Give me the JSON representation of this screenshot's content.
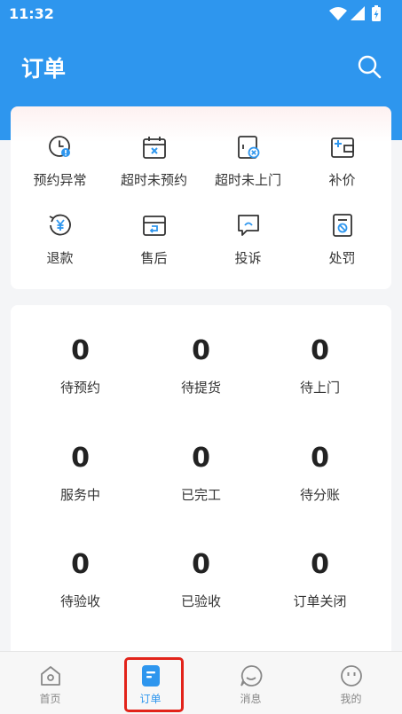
{
  "status_bar": {
    "time": "11:32"
  },
  "header": {
    "title": "订单"
  },
  "quick_actions": [
    {
      "label": "预约异常",
      "icon": "clock-alert-icon"
    },
    {
      "label": "超时未预约",
      "icon": "calendar-x-icon"
    },
    {
      "label": "超时未上门",
      "icon": "door-x-icon"
    },
    {
      "label": "补价",
      "icon": "wallet-plus-icon"
    },
    {
      "label": "退款",
      "icon": "refund-yen-icon"
    },
    {
      "label": "售后",
      "icon": "box-return-icon"
    },
    {
      "label": "投诉",
      "icon": "complaint-message-icon"
    },
    {
      "label": "处罚",
      "icon": "penalty-doc-icon"
    }
  ],
  "stats": [
    {
      "count": "0",
      "label": "待预约"
    },
    {
      "count": "0",
      "label": "待提货"
    },
    {
      "count": "0",
      "label": "待上门"
    },
    {
      "count": "0",
      "label": "服务中"
    },
    {
      "count": "0",
      "label": "已完工"
    },
    {
      "count": "0",
      "label": "待分账"
    },
    {
      "count": "0",
      "label": "待验收"
    },
    {
      "count": "0",
      "label": "已验收"
    },
    {
      "count": "0",
      "label": "订单关闭"
    }
  ],
  "tabbar": [
    {
      "label": "首页",
      "icon": "home-icon"
    },
    {
      "label": "订单",
      "icon": "order-icon",
      "active": true
    },
    {
      "label": "消息",
      "icon": "message-icon"
    },
    {
      "label": "我的",
      "icon": "profile-icon"
    }
  ],
  "colors": {
    "primary": "#2e96ee",
    "highlight": "#e2231a"
  }
}
